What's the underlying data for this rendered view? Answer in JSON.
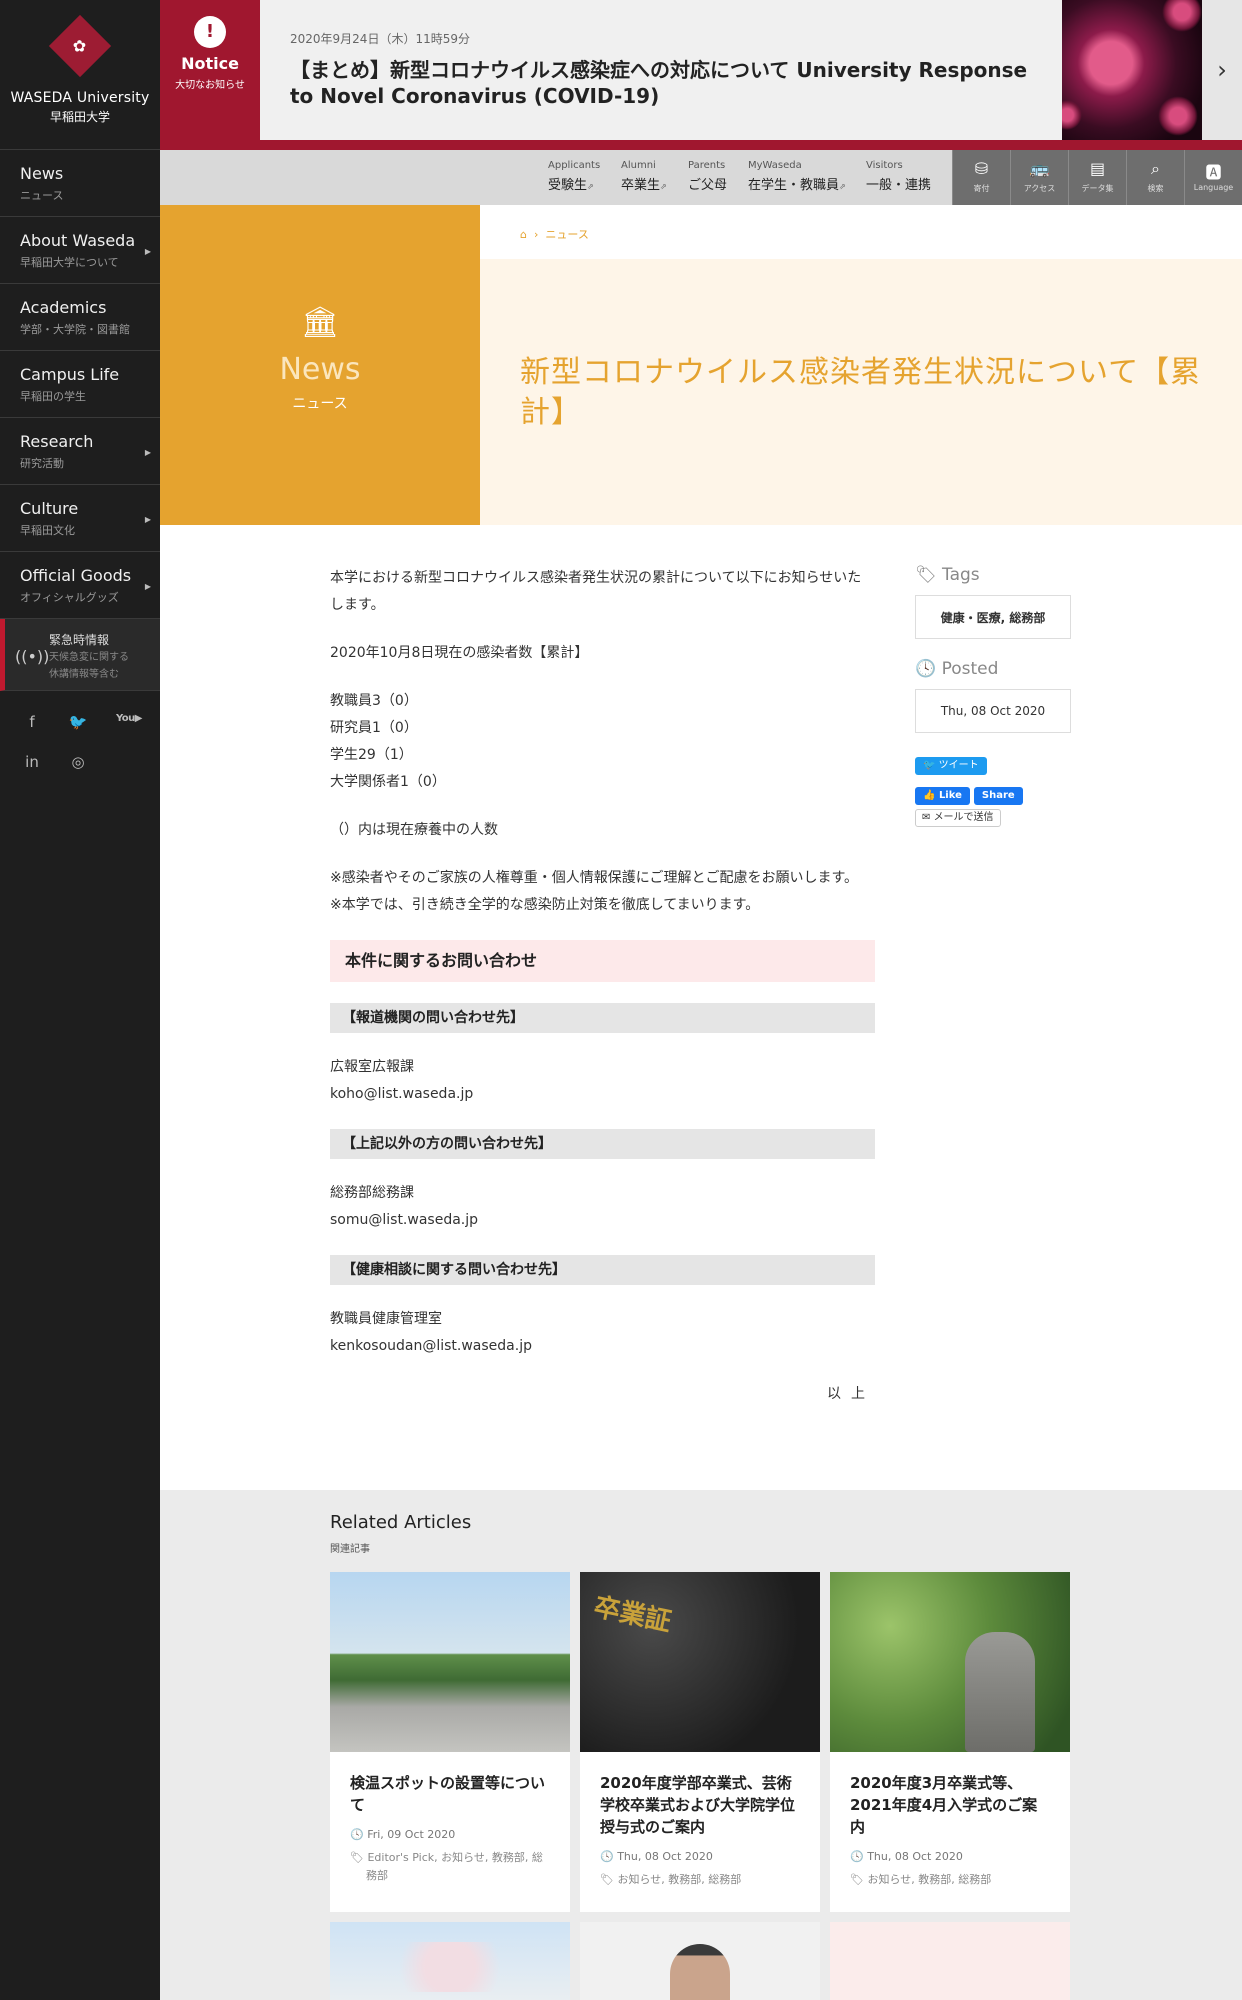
{
  "brand": {
    "name_en": "WASEDA University",
    "name_ja": "早稲田大学"
  },
  "sidebar": {
    "items": [
      {
        "en": "News",
        "ja": "ニュース",
        "arrow": false
      },
      {
        "en": "About Waseda",
        "ja": "早稲田大学について",
        "arrow": true
      },
      {
        "en": "Academics",
        "ja": "学部・大学院・図書館",
        "arrow": false
      },
      {
        "en": "Campus Life",
        "ja": "早稲田の学生",
        "arrow": false
      },
      {
        "en": "Research",
        "ja": "研究活動",
        "arrow": true
      },
      {
        "en": "Culture",
        "ja": "早稲田文化",
        "arrow": true
      },
      {
        "en": "Official Goods",
        "ja": "オフィシャルグッズ",
        "arrow": true
      }
    ],
    "emergency": {
      "title": "緊急時情報",
      "sub1": "天候急変に関する",
      "sub2": "休講情報等含む"
    },
    "social": [
      "f",
      "twitter",
      "YouTube",
      "in",
      "instagram"
    ]
  },
  "notice": {
    "label": "Notice",
    "sub": "大切なお知らせ",
    "date": "2020年9月24日（木）11時59分",
    "title": "【まとめ】新型コロナウイルス感染症への対応について University Response to Novel Coronavirus (COVID-19)"
  },
  "topnav": {
    "audiences": [
      {
        "en": "Applicants",
        "ja": "受験生"
      },
      {
        "en": "Alumni",
        "ja": "卒業生"
      },
      {
        "en": "Parents",
        "ja": "ご父母"
      },
      {
        "en": "MyWaseda",
        "ja": "在学生・教職員"
      },
      {
        "en": "Visitors",
        "ja": "一般・連携"
      }
    ],
    "utilities": [
      {
        "icon": "donate-icon",
        "label": "寄付"
      },
      {
        "icon": "bus-icon",
        "label": "アクセス"
      },
      {
        "icon": "book-icon",
        "label": "データ集"
      },
      {
        "icon": "search-icon",
        "label": "検索"
      },
      {
        "icon": "language-icon",
        "label": "Language"
      }
    ]
  },
  "hero": {
    "en": "News",
    "ja": "ニュース",
    "breadcrumb": "ニュース",
    "title": "新型コロナウイルス感染者発生状況について【累計】"
  },
  "article": {
    "intro": "本学における新型コロナウイルス感染者発生状況の累計について以下にお知らせいたします。",
    "as_of": "2020年10月8日現在の感染者数【累計】",
    "counts": [
      "教職員3（0）",
      "研究員1（0）",
      "学生29（1）",
      "大学関係者1（0）"
    ],
    "note": "（）内は現在療養中の人数",
    "request1": "※感染者やそのご家族の人権尊重・個人情報保護にご理解とご配慮をお願いします。",
    "request2": "※本学では、引き続き全学的な感染防止対策を徹底してまいります。",
    "contact_heading": "本件に関するお問い合わせ",
    "contacts": [
      {
        "heading": "【報道機関の問い合わせ先】",
        "dept": "広報室広報課",
        "email": "koho@list.waseda.jp"
      },
      {
        "heading": "【上記以外の方の問い合わせ先】",
        "dept": "総務部総務課",
        "email": "somu@list.waseda.jp"
      },
      {
        "heading": "【健康相談に関する問い合わせ先】",
        "dept": "教職員健康管理室",
        "email": "kenkosoudan@list.waseda.jp"
      }
    ],
    "closing": "以上"
  },
  "aside": {
    "tags_label": "Tags",
    "tags_value": "健康・医療, 総務部",
    "posted_label": "Posted",
    "posted_value": "Thu, 08 Oct 2020",
    "tweet": "ツイート",
    "fb_like": "Like",
    "fb_share": "Share",
    "mail": "メールで送信"
  },
  "related": {
    "title": "Related Articles",
    "sub": "関連記事",
    "cards": [
      {
        "title": "検温スポットの設置等について",
        "date": "Fri, 09 Oct 2020",
        "tags": "Editor's Pick, お知らせ, 教務部, 総務部"
      },
      {
        "title": "2020年度学部卒業式、芸術学校卒業式および大学院学位授与式のご案内",
        "date": "Thu, 08 Oct 2020",
        "tags": "お知らせ, 教務部, 総務部"
      },
      {
        "title": "2020年度3月卒業式等、2021年度4月入学式のご案内",
        "date": "Thu, 08 Oct 2020",
        "tags": "お知らせ, 教務部, 総務部"
      }
    ]
  },
  "colors": {
    "crimson": "#a0172f",
    "gold": "#e5a32f",
    "dark": "#1e1e1e"
  }
}
